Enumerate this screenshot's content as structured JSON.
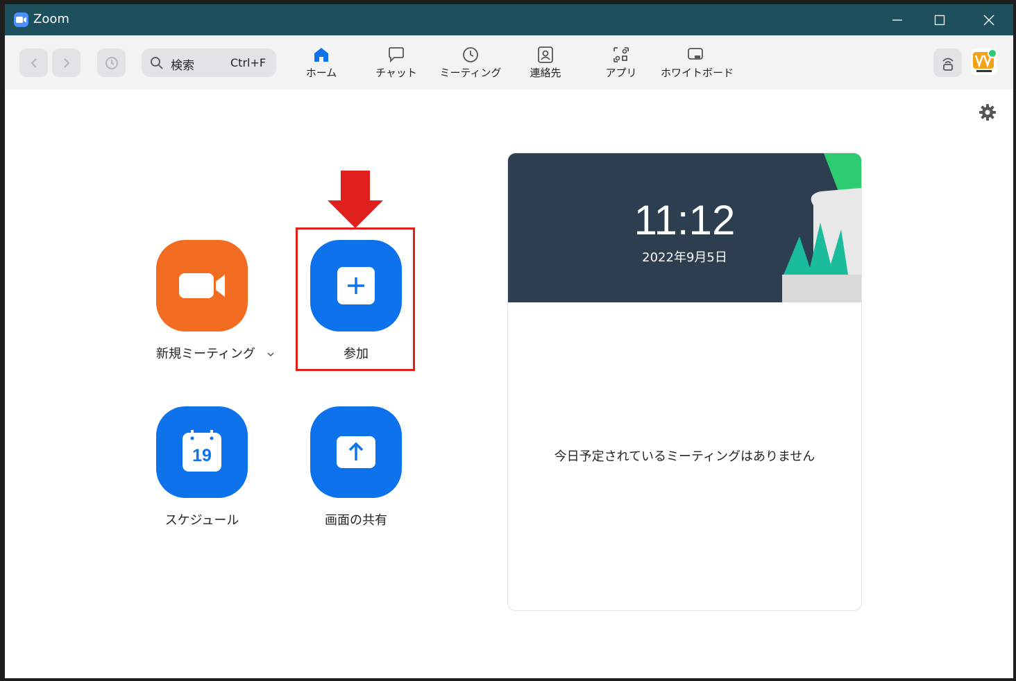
{
  "window": {
    "title": "Zoom"
  },
  "toolbar": {
    "search_label": "検索",
    "search_shortcut": "Ctrl+F",
    "tabs": [
      {
        "label": "ホーム",
        "icon": "home-icon",
        "active": true
      },
      {
        "label": "チャット",
        "icon": "chat-icon",
        "active": false
      },
      {
        "label": "ミーティング",
        "icon": "clock-icon",
        "active": false
      },
      {
        "label": "連絡先",
        "icon": "contacts-icon",
        "active": false
      },
      {
        "label": "アプリ",
        "icon": "apps-icon",
        "active": false
      },
      {
        "label": "ホワイトボード",
        "icon": "whiteboard-icon",
        "active": false
      }
    ]
  },
  "actions": {
    "new_meeting": "新規ミーティング",
    "join": "参加",
    "schedule": "スケジュール",
    "schedule_day": "19",
    "share_screen": "画面の共有"
  },
  "meetings_card": {
    "time": "11:12",
    "date": "2022年9月5日",
    "empty_message": "今日予定されているミーティングはありません"
  },
  "colors": {
    "titlebar": "#1d4f5d",
    "primary_blue": "#0e72ed",
    "orange": "#f26d21",
    "highlight_red": "#e0201d"
  }
}
